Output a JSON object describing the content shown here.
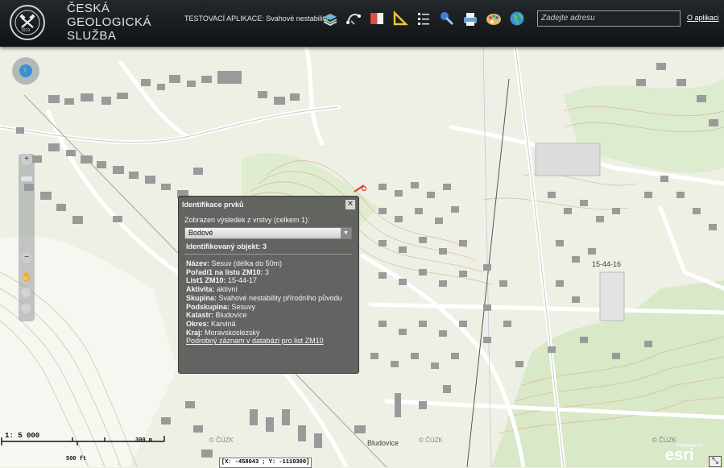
{
  "header": {
    "org_lines": [
      "ČESKÁ",
      "GEOLOGICKÁ",
      "SLUŽBA"
    ],
    "emblem_year": "1919",
    "emblem_text": "ČESKÁ GEOLOGICKÁ SLUŽBA",
    "app_label": "TESTOVACÍ APLIKACE: Svahové nestability",
    "toolbar": [
      "layers-icon",
      "measure-icon",
      "book-icon",
      "ruler-icon",
      "list-icon",
      "pin-icon",
      "print-icon",
      "palette-icon",
      "globe-icon"
    ],
    "search_placeholder": "Zadejte adresu",
    "about_label": "O aplikaci"
  },
  "popup": {
    "title": "Identifikace prvků",
    "close_label": "✕",
    "result_text": "Zobrazen výsledek z vrstvy (celkem 1):",
    "layer_select": "Bodové",
    "identified": "Identifikovaný objekt: 3",
    "attrs": [
      {
        "label": "Název:",
        "value": "Sesuv (délka do 50m)"
      },
      {
        "label": "Pořadí1 na listu ZM10:",
        "value": "3"
      },
      {
        "label": "List1 ZM10:",
        "value": "15-44-17"
      },
      {
        "label": "Aktivita:",
        "value": "aktivní"
      },
      {
        "label": "Skupina:",
        "value": "Svahové nestability přírodního původu"
      },
      {
        "label": "Podskupina:",
        "value": "Sesuvy"
      },
      {
        "label": "Katastr:",
        "value": "Bludovice"
      },
      {
        "label": "Okres:",
        "value": "Karviná"
      },
      {
        "label": "Kraj:",
        "value": "Moravskoslezský"
      }
    ],
    "detail_link": "Podrobný záznam v databázi pro list ZM10"
  },
  "map": {
    "scale_ratio": "1: 5 000",
    "scale_metric": "300 m",
    "scale_imperial": "500 ft",
    "coordinates": "[X: -458043 ; Y: -1110300]",
    "copyright": "© ČÚZK",
    "place_label": "Bludovice",
    "sheet_label": "15-44-16",
    "esri_powered": "POWERED BY",
    "esri_logo": "esri"
  },
  "colors": {
    "header": "#1a1f21",
    "popup": "#585956",
    "map_bg": "#eef0e6",
    "building": "#9a9a9a",
    "road": "#ffffff",
    "contour": "#cfa98a",
    "forest": "#cfe4b8"
  }
}
